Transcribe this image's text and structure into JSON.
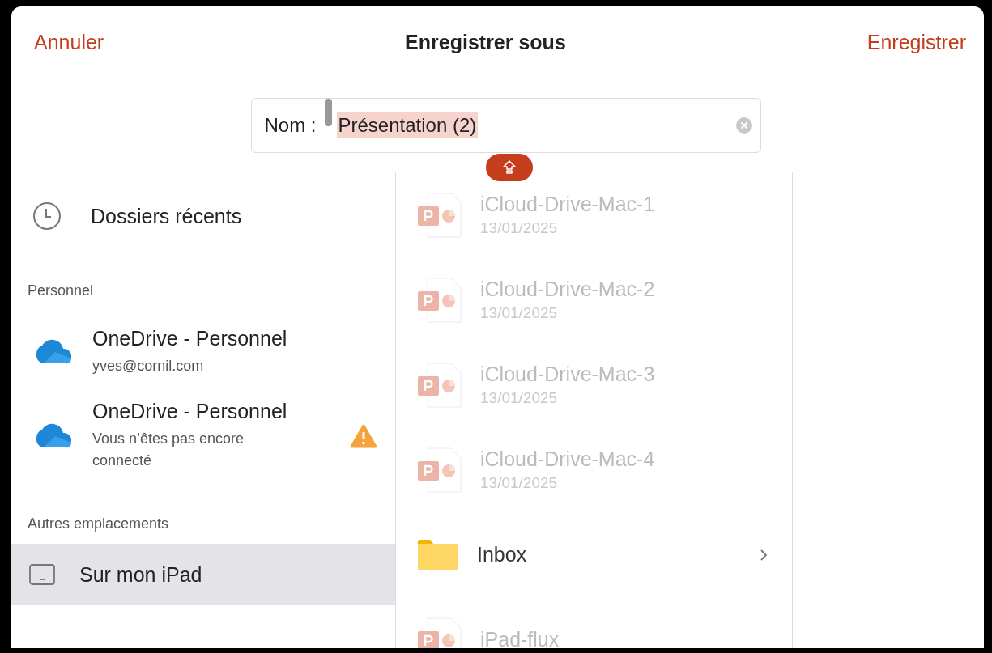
{
  "header": {
    "cancel": "Annuler",
    "title": "Enregistrer sous",
    "save": "Enregistrer"
  },
  "name_field": {
    "label": "Nom :",
    "value": "Présentation (2)",
    "selected_text": true
  },
  "sidebar": {
    "recent": {
      "label": "Dossiers récents"
    },
    "sections": [
      {
        "title": "Personnel",
        "items": [
          {
            "kind": "account",
            "name": "OneDrive - Personnel",
            "detail": "yves@cornil.com",
            "warning": false,
            "selected": false
          },
          {
            "kind": "account",
            "name": "OneDrive - Personnel",
            "detail": "Vous n’êtes pas encore connecté",
            "warning": true,
            "selected": false
          }
        ]
      },
      {
        "title": "Autres emplacements",
        "items": [
          {
            "kind": "device",
            "name": "Sur mon iPad",
            "selected": true
          }
        ]
      }
    ]
  },
  "files": [
    {
      "kind": "file",
      "name": "iCloud-Drive-Mac-1",
      "date": "13/01/2025",
      "disabled": true
    },
    {
      "kind": "file",
      "name": "iCloud-Drive-Mac-2",
      "date": "13/01/2025",
      "disabled": true
    },
    {
      "kind": "file",
      "name": "iCloud-Drive-Mac-3",
      "date": "13/01/2025",
      "disabled": true
    },
    {
      "kind": "file",
      "name": "iCloud-Drive-Mac-4",
      "date": "13/01/2025",
      "disabled": true
    },
    {
      "kind": "folder",
      "name": "Inbox",
      "disabled": false
    },
    {
      "kind": "file",
      "name": "iPad-flux",
      "disabled": true
    }
  ]
}
